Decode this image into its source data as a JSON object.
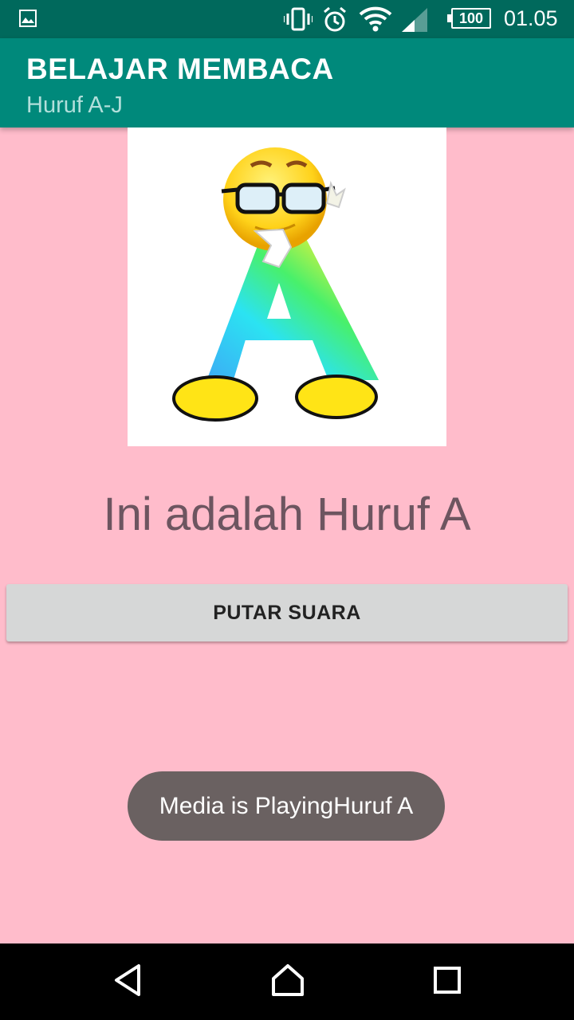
{
  "status_bar": {
    "battery": "100",
    "time": "01.05",
    "icons": [
      "gallery-icon",
      "vibrate-icon",
      "alarm-icon",
      "wifi-icon",
      "signal-icon",
      "battery-icon"
    ]
  },
  "app_bar": {
    "title": "BELAJAR MEMBACA",
    "subtitle": "Huruf A-J"
  },
  "content": {
    "image": "emoji-letter-a",
    "caption": "Ini adalah Huruf A",
    "play_button_label": "PUTAR SUARA"
  },
  "toast": {
    "message": "Media is PlayingHuruf A"
  },
  "nav_bar": {
    "buttons": [
      "back-icon",
      "home-icon",
      "recents-icon"
    ]
  },
  "colors": {
    "background": "#FFBCCB",
    "app_bar": "#00897B",
    "status_bar": "#00695C",
    "caption": "#6D5560"
  }
}
